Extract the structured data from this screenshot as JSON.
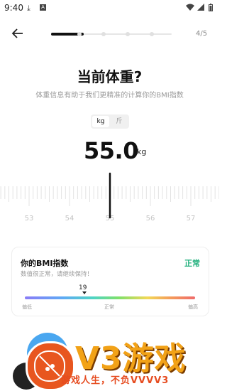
{
  "status_bar": {
    "time": "9:40",
    "icons": [
      "download-icon",
      "a-icon",
      "wifi-icon",
      "signal-icon",
      "battery-icon"
    ]
  },
  "nav": {
    "back_icon": "arrow-left-icon",
    "step": "4/5",
    "progress": {
      "total_steps": 5,
      "current_step": 4
    }
  },
  "header": {
    "title": "当前体重?",
    "subtitle": "体重信息有助于我们更精准的计算你的BMI指数"
  },
  "unit_toggle": {
    "options": [
      "kg",
      "斤"
    ],
    "selected": "kg"
  },
  "weight": {
    "value": "55.0",
    "unit": "kg"
  },
  "ruler": {
    "labels": [
      "53",
      "54",
      "55",
      "56",
      "57"
    ],
    "selected": 55
  },
  "bmi_card": {
    "title": "你的BMI指数",
    "status": "正常",
    "description": "数值很正常，请继续保持！",
    "value": "19",
    "scale_labels": {
      "low": "偏低",
      "mid": "正常",
      "high": "偏高"
    }
  },
  "watermark": {
    "brand": "V3游戏",
    "slogan": "游戏人生，不负VVVV3"
  },
  "colors": {
    "accent": "#111111",
    "normal": "#22b07d",
    "watermark_orange": "#f2a217",
    "watermark_red": "#e64b1f"
  }
}
